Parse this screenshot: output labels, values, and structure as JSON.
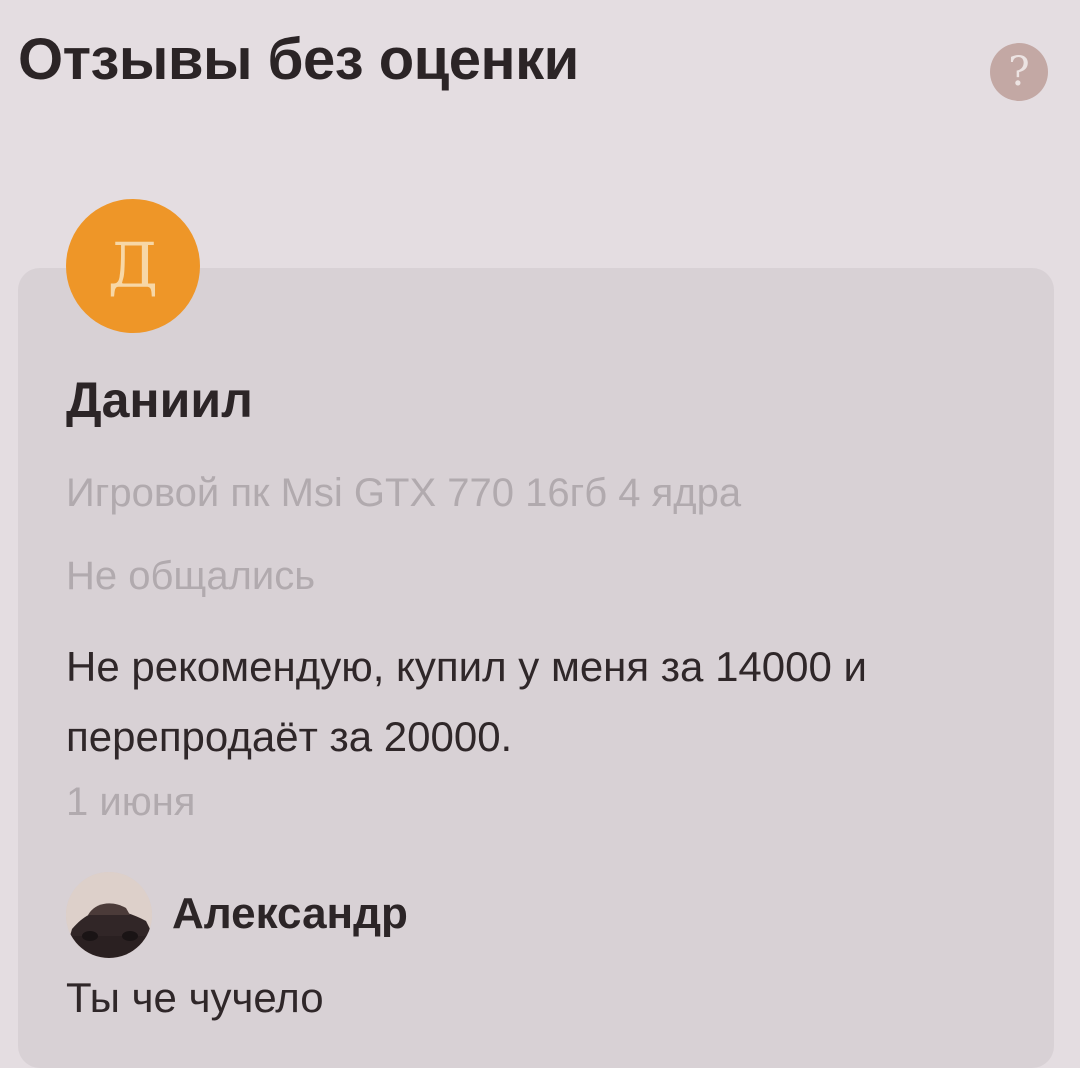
{
  "header": {
    "title": "Отзывы без оценки",
    "help_icon": "question-circle-icon",
    "help_glyph": "?"
  },
  "review": {
    "avatar_letter": "Д",
    "avatar_color": "#ee9628",
    "author": "Даниил",
    "product": "Игровой пк Msi GTX 770 16гб 4 ядра",
    "deal_status": "Не общались",
    "text": "Не рекомендую, купил у меня за 14000 и перепродаёт за 20000.",
    "date": "1 июня"
  },
  "reply": {
    "avatar_icon": "car-photo-avatar",
    "author": "Александр",
    "text": "Ты че чучело"
  }
}
